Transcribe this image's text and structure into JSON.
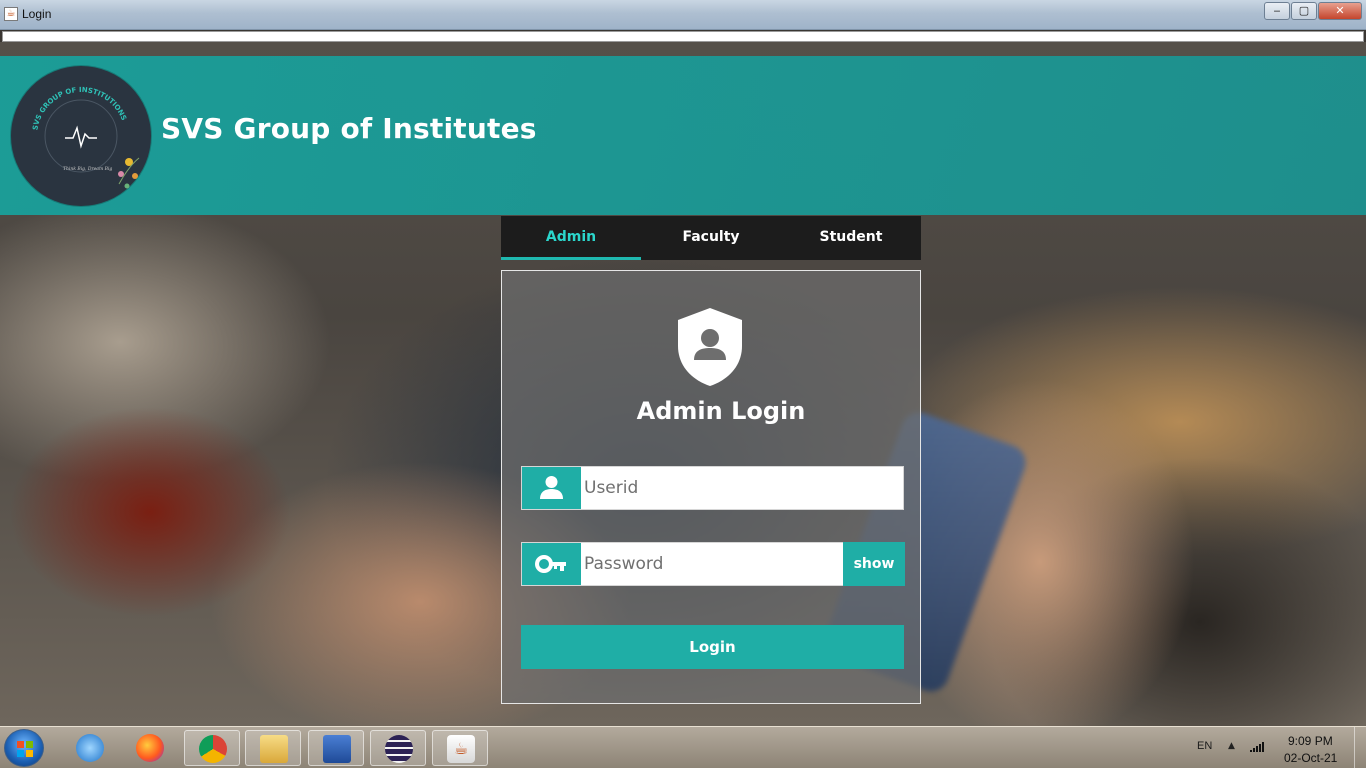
{
  "window": {
    "title": "Login",
    "controls": {
      "minimize": "‒",
      "maximize": "▢",
      "close": "✕"
    }
  },
  "header": {
    "org_name": "SVS Group of Institutes",
    "logo": {
      "ring_text": "SVS GROUP OF INSTITUTIONS",
      "tagline": "Think Big, Dream Big"
    }
  },
  "tabs": [
    {
      "label": "Admin",
      "active": true
    },
    {
      "label": "Faculty",
      "active": false
    },
    {
      "label": "Student",
      "active": false
    }
  ],
  "login": {
    "title": "Admin Login",
    "userid_placeholder": "Userid",
    "userid_value": "",
    "password_placeholder": "Password",
    "password_value": "",
    "show_label": "show",
    "submit_label": "Login"
  },
  "taskbar": {
    "pinned": [
      "internet-explorer-icon",
      "firefox-icon",
      "chrome-icon",
      "file-explorer-icon",
      "word-icon",
      "eclipse-icon",
      "java-icon"
    ],
    "language": "EN",
    "time": "9:09 PM",
    "date": "02-Oct-21"
  },
  "colors": {
    "accent": "#1faea6",
    "active_tab_text": "#2bd6cc",
    "tab_bar": "#1c1c1c"
  }
}
